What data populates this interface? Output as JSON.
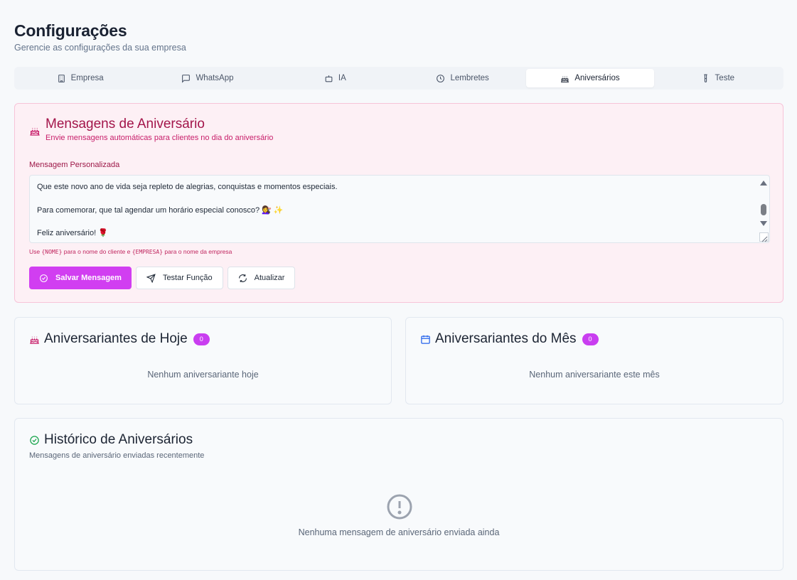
{
  "page": {
    "title": "Configurações",
    "subtitle": "Gerencie as configurações da sua empresa"
  },
  "tabs": [
    {
      "label": "Empresa",
      "icon": "building-icon"
    },
    {
      "label": "WhatsApp",
      "icon": "message-square-icon"
    },
    {
      "label": "IA",
      "icon": "bot-icon"
    },
    {
      "label": "Lembretes",
      "icon": "clock-icon"
    },
    {
      "label": "Aniversários",
      "icon": "cake-icon",
      "active": true
    },
    {
      "label": "Teste",
      "icon": "test-tube-icon"
    }
  ],
  "message_card": {
    "title": "Mensagens de Aniversário",
    "subtitle": "Envie mensagens automáticas para clientes no dia do aniversário",
    "field_label": "Mensagem Personalizada",
    "textarea_lines": [
      "Que este novo ano de vida seja repleto de alegrias, conquistas e momentos especiais.",
      "Para comemorar, que tal agendar um horário especial conosco? 💇‍♀️ ✨",
      "Feliz aniversário! 🌹"
    ],
    "hint_prefix": "Use ",
    "hint_nome": "{NOME}",
    "hint_middle": " para o nome do cliente e ",
    "hint_empresa": "{EMPRESA}",
    "hint_suffix": " para o nome da empresa",
    "buttons": {
      "save": "Salvar Mensagem",
      "test": "Testar Função",
      "refresh": "Atualizar"
    }
  },
  "today": {
    "title": "Aniversariantes de Hoje",
    "count": "0",
    "empty": "Nenhum aniversariante hoje"
  },
  "month": {
    "title": "Aniversariantes do Mês",
    "count": "0",
    "empty": "Nenhum aniversariante este mês"
  },
  "history": {
    "title": "Histórico de Aniversários",
    "subtitle": "Mensagens de aniversário enviadas recentemente",
    "empty": "Nenhuma mensagem de aniversário enviada ainda"
  },
  "colors": {
    "accent": "#d13ef1",
    "pink_title": "#a3154a",
    "pink_bg": "#fdf0f5",
    "success": "#16a34a",
    "calendar": "#2563eb"
  }
}
